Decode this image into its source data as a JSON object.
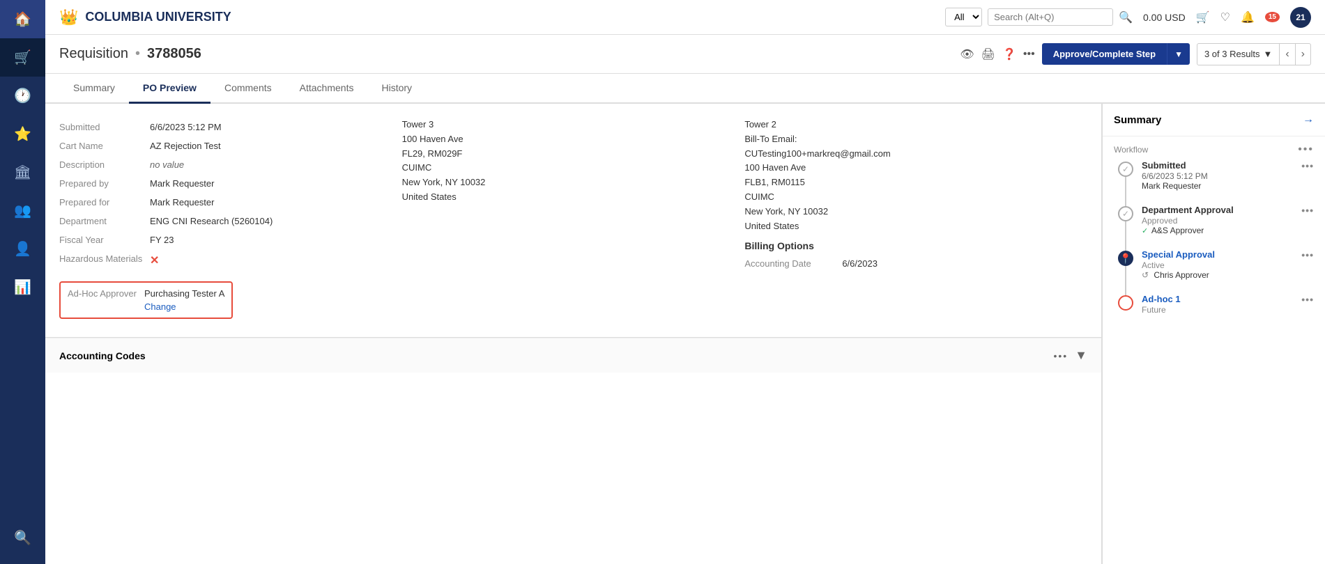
{
  "topNav": {
    "logo": "COLUMBIA UNIVERSITY",
    "logoIcon": "👑",
    "searchDropdown": "All",
    "searchPlaceholder": "Search (Alt+Q)",
    "price": "0.00 USD",
    "notificationCount": "15",
    "userCount": "21"
  },
  "pageHeader": {
    "title": "Requisition",
    "dot": "•",
    "reqNumber": "3788056",
    "approveButton": "Approve/Complete Step",
    "resultsLabel": "3 of 3 Results"
  },
  "tabs": [
    {
      "label": "Summary",
      "active": false
    },
    {
      "label": "PO Preview",
      "active": true
    },
    {
      "label": "Comments",
      "active": false
    },
    {
      "label": "Attachments",
      "active": false
    },
    {
      "label": "History",
      "active": false
    }
  ],
  "requisitionInfo": {
    "submittedLabel": "Submitted",
    "submittedValue": "6/6/2023 5:12 PM",
    "cartNameLabel": "Cart Name",
    "cartNameValue": "AZ Rejection Test",
    "descriptionLabel": "Description",
    "descriptionValue": "no value",
    "preparedByLabel": "Prepared by",
    "preparedByValue": "Mark Requester",
    "preparedForLabel": "Prepared for",
    "preparedForValue": "Mark Requester",
    "departmentLabel": "Department",
    "departmentValue": "ENG CNI Research (5260104)",
    "fiscalYearLabel": "Fiscal Year",
    "fiscalYearValue": "FY 23",
    "hazardousLabel": "Hazardous Materials",
    "hazardousValue": "✗",
    "adHocLabel": "Ad-Hoc Approver",
    "adHocValue": "Purchasing Tester A",
    "adHocChange": "Change"
  },
  "shipToAddress": {
    "title": "Tower 3",
    "line1": "100 Haven Ave",
    "line2": "FL29, RM029F",
    "line3": "CUIMC",
    "line4": "New York, NY 10032",
    "line5": "United States"
  },
  "billToAddress": {
    "title": "Tower 2",
    "emailLabel": "Bill-To Email:",
    "email": "CUTesting100+markreq@gmail.com",
    "line1": "100 Haven Ave",
    "line2": "FLB1, RM0115",
    "line3": "CUIMC",
    "line4": "New York, NY 10032",
    "line5": "United States"
  },
  "billingOptions": {
    "title": "Billing Options",
    "accountingDateLabel": "Accounting Date",
    "accountingDateValue": "6/6/2023"
  },
  "accountingCodes": {
    "title": "Accounting Codes"
  },
  "summary": {
    "title": "Summary",
    "arrowIcon": "→",
    "workflowLabel": "Workflow",
    "timeline": [
      {
        "id": "submitted",
        "title": "Submitted",
        "status": "completed",
        "date": "6/6/2023 5:12 PM",
        "person": "Mark Requester",
        "icon": "✓"
      },
      {
        "id": "department-approval",
        "title": "Department Approval",
        "status": "completed",
        "statusLabel": "Approved",
        "person": "A&S Approver",
        "icon": "✓"
      },
      {
        "id": "special-approval",
        "title": "Special Approval",
        "status": "active",
        "statusLabel": "Active",
        "person": "Chris Approver",
        "icon": "📍"
      },
      {
        "id": "adhoc-1",
        "title": "Ad-hoc 1",
        "status": "future",
        "statusLabel": "Future",
        "icon": ""
      }
    ]
  }
}
